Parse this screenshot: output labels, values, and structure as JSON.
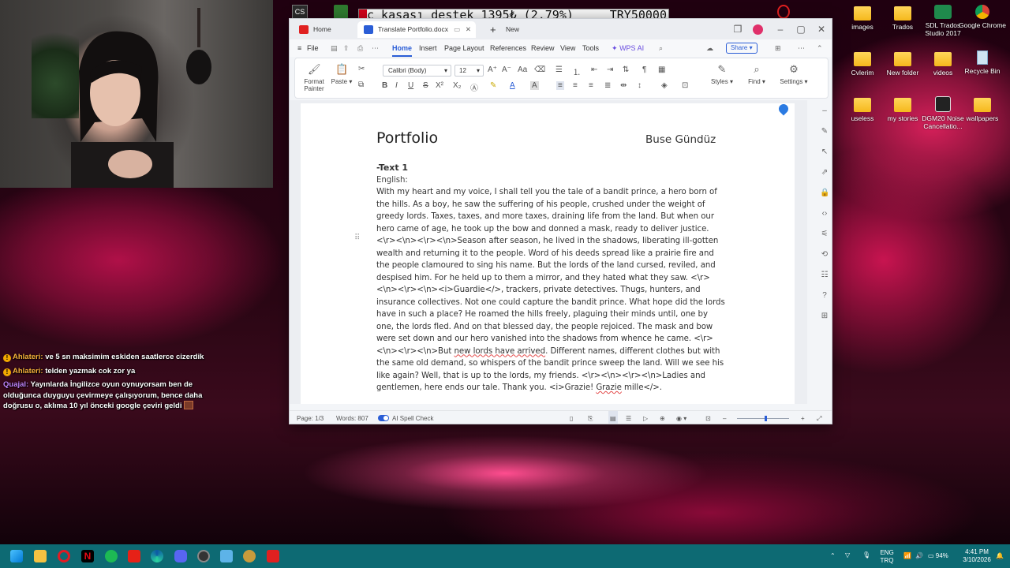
{
  "ticker": {
    "text": "c kasası destek 1395₺ (2.79%)",
    "goal": "TRY50000"
  },
  "chat": [
    {
      "user": "Ahlateri:",
      "message": "ve 5 sn maksimim eskiden saatlerce cizerdik"
    },
    {
      "user": "Ahlateri:",
      "message": "telden yazmak cok zor ya"
    },
    {
      "user": "Quajal:",
      "message": "Yayınlarda İngilizce oyun oynuyorsam ben de olduğunca duyguyu çevirmeye çalışıyorum, bence daha doğrusu o, aklıma 10 yıl önceki google çeviri geldi"
    }
  ],
  "desktop_icons": [
    {
      "label": "images"
    },
    {
      "label": "Trados"
    },
    {
      "label": "SDL Trados Studio 2017"
    },
    {
      "label": "Google Chrome"
    },
    {
      "label": "Cvlerim"
    },
    {
      "label": "New folder"
    },
    {
      "label": "videos"
    },
    {
      "label": "Recycle Bin"
    },
    {
      "label": "useless"
    },
    {
      "label": "my stories"
    },
    {
      "label": "DGM20 Noise Cancellatio..."
    },
    {
      "label": "wallpapers"
    }
  ],
  "window": {
    "tabs": {
      "home": "Home",
      "doc": "Translate Portfolio.docx",
      "new": "New"
    },
    "menu": {
      "file": "File",
      "home": "Home",
      "insert": "Insert",
      "page_layout": "Page Layout",
      "references": "References",
      "review": "Review",
      "view": "View",
      "tools": "Tools",
      "wps_ai": "WPS AI"
    },
    "share": "Share",
    "ribbon": {
      "format_painter": "Format Painter",
      "paste": "Paste",
      "font": "Calibri (Body)",
      "size": "12",
      "styles": "Styles",
      "find": "Find",
      "settings": "Settings"
    }
  },
  "document": {
    "title": "Portfolio",
    "author": "Buse Gündüz",
    "heading": "-Text 1",
    "sublabel": "English:",
    "p1": "With my heart and my voice, I shall tell you the tale of a bandit prince, a hero born of the hills. As a boy, he saw the suffering of his people, crushed under the weight of greedy lords. Taxes, taxes, and more taxes, draining life from the land. But when our hero came of age, he took up the bow and donned a mask, ready to deliver justice. <\\r><\\n><\\r><\\n>Season after season, he lived in the shadows, liberating ill-gotten wealth and returning it to the people. Word of his deeds spread like a prairie fire and the people clamoured to sing his name. But the lords of the land cursed, reviled, and despised him. For he held up to them a mirror, and they hated what they saw. <\\r><\\n><\\r><\\n><i>Guardie</>, trackers, private detectives. Thugs, hunters, and insurance collectives. Not one could capture the bandit prince. What hope did the lords have in such a place? He roamed the hills freely, plaguing their minds until, one by one, the lords fled. And on that blessed day, the people rejoiced. The mask and bow were set down and our hero vanished into the shadows from whence he came. <\\r><\\n><\\r><\\n>But ",
    "p1_squig": "new lords have arrived",
    "p2": ". Different names, different clothes but with the same old demand, so whispers of the bandit prince sweep the land. Will we see his like again? Well, that is up to the lords, my friends. <\\r><\\n><\\r><\\n>Ladies and gentlemen, here ends our tale. Thank you. <i>Grazie! ",
    "p2_squig": "Grazie",
    "p3": " mille</>."
  },
  "status": {
    "page": "Page: 1/3",
    "words": "Words: 807",
    "spell": "AI Spell Check"
  },
  "taskbar": {
    "lang": "ENG",
    "lang2": "TRQ",
    "battery": "94%",
    "time": "4:41 PM",
    "date": "3/10/2026"
  }
}
